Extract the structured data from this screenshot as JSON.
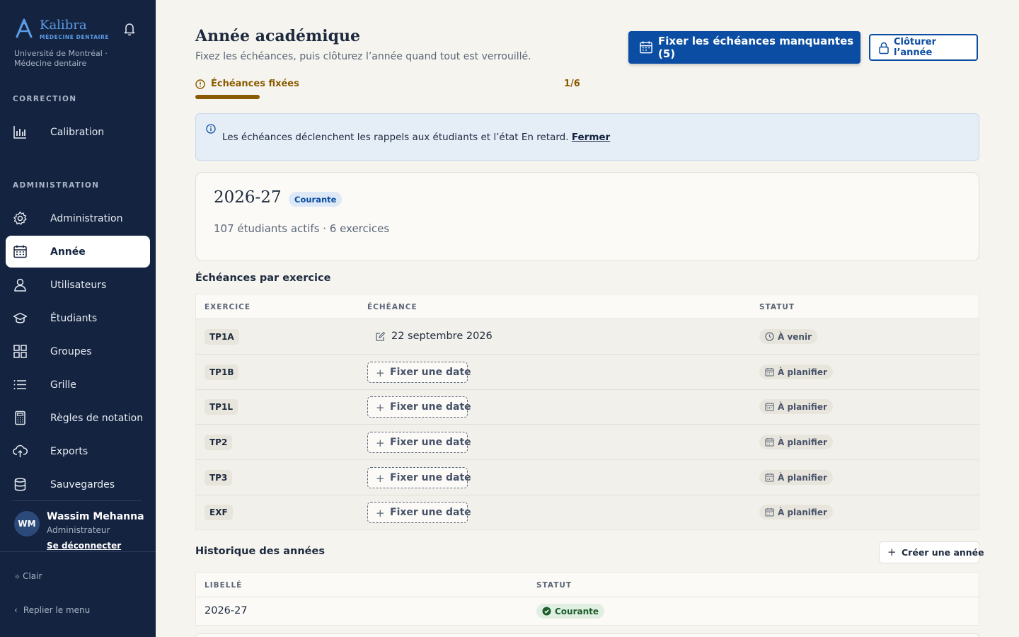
{
  "brand": {
    "name": "Kalibra",
    "sub": "MÉDECINE DENTAIRE",
    "institution": "Université de Montréal · Médecine dentaire"
  },
  "sidebar": {
    "section_correction": "CORRECTION",
    "section_admin": "ADMINISTRATION",
    "items": [
      {
        "label": "Calibration",
        "icon": "bar-chart-icon"
      },
      {
        "label": "Administration",
        "icon": "gear-icon"
      },
      {
        "label": "Année",
        "icon": "calendar-icon",
        "active": true
      },
      {
        "label": "Utilisateurs",
        "icon": "user-icon"
      },
      {
        "label": "Étudiants",
        "icon": "graduation-cap-icon"
      },
      {
        "label": "Groupes",
        "icon": "grid-icon"
      },
      {
        "label": "Grille",
        "icon": "list-icon"
      },
      {
        "label": "Règles de notation",
        "icon": "calculator-icon"
      },
      {
        "label": "Exports",
        "icon": "cloud-upload-icon"
      },
      {
        "label": "Sauvegardes",
        "icon": "database-icon"
      }
    ],
    "user": {
      "initials": "WM",
      "name": "Wassim Mehanna",
      "role": "Administrateur",
      "logout": "Se déconnecter"
    },
    "theme": "Clair",
    "collapse": "Replier le menu"
  },
  "header": {
    "title": "Année académique",
    "subtitle": "Fixez les échéances, puis clôturez l’année quand tout est verrouillé.",
    "primary_button": "Fixer les échéances manquantes (5)",
    "close_button": "Clôturer l’année"
  },
  "progress": {
    "label": "Échéances fixées",
    "count": "1/6",
    "fraction": 0.1667
  },
  "info": {
    "text": "Les échéances déclenchent les rappels aux étudiants et l’état En retard.",
    "link": "Fermer"
  },
  "year": {
    "title": "2026-27",
    "badge": "Courante",
    "meta": "107 étudiants actifs · 6 exercices"
  },
  "deadlines": {
    "title": "Échéances par exercice",
    "columns": [
      "EXERCICE",
      "ÉCHÉANCE",
      "STATUT"
    ],
    "fix_label": "Fixer une date",
    "rows": [
      {
        "code": "TP1A",
        "date": "22 septembre 2026",
        "status": "À venir"
      },
      {
        "code": "TP1B",
        "date": null,
        "status": "À planifier"
      },
      {
        "code": "TP1L",
        "date": null,
        "status": "À planifier"
      },
      {
        "code": "TP2",
        "date": null,
        "status": "À planifier"
      },
      {
        "code": "TP3",
        "date": null,
        "status": "À planifier"
      },
      {
        "code": "EXF",
        "date": null,
        "status": "À planifier"
      }
    ]
  },
  "history": {
    "title": "Historique des années",
    "create_button": "Créer une année",
    "columns": [
      "LIBELLÉ",
      "STATUT"
    ],
    "rows": [
      {
        "label": "2026-27",
        "status": "Courante"
      }
    ]
  },
  "colors": {
    "sidebar_bg": "#14233f",
    "accent": "#0b4da2",
    "warning": "#8a5a00",
    "success": "#1b5e2a"
  }
}
